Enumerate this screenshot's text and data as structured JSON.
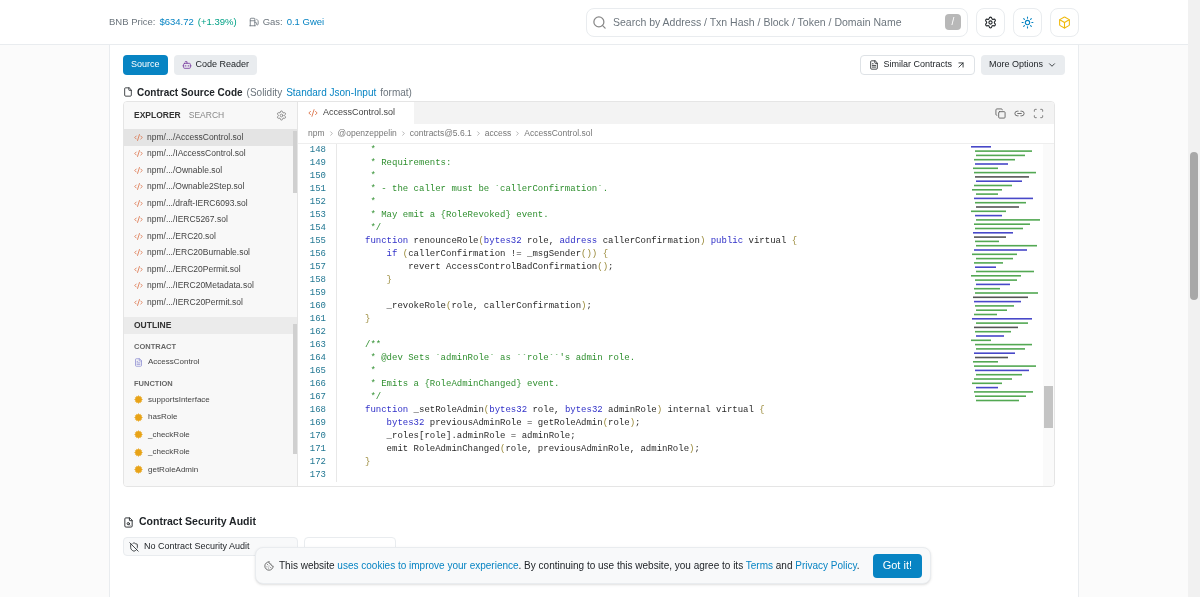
{
  "header": {
    "price_label": "BNB Price:",
    "price": "$634.72",
    "price_change": "(+1.39%)",
    "gas_label": "Gas:",
    "gas": "0.1 Gwei",
    "search": {
      "placeholder": "Search by Address / Txn Hash / Block / Token / Domain Name",
      "shortcut": "/"
    }
  },
  "view_tabs": [
    {
      "label": "Source",
      "selected": true
    },
    {
      "label": "Code Reader",
      "selected": false
    }
  ],
  "actions": {
    "similar": "Similar Contracts",
    "more": "More Options"
  },
  "source_title": {
    "bold": "Contract Source Code",
    "before": "(Solidity",
    "link": "Standard Json-Input",
    "after": "format)"
  },
  "sidebar": {
    "tabs": [
      {
        "label": "EXPLORER",
        "selected": true
      },
      {
        "label": "SEARCH",
        "selected": false
      }
    ],
    "files": [
      {
        "name": "npm/.../AccessControl.sol",
        "selected": true
      },
      {
        "name": "npm/.../IAccessControl.sol",
        "selected": false
      },
      {
        "name": "npm/.../Ownable.sol",
        "selected": false
      },
      {
        "name": "npm/.../Ownable2Step.sol",
        "selected": false
      },
      {
        "name": "npm/.../draft-IERC6093.sol",
        "selected": false
      },
      {
        "name": "npm/.../IERC5267.sol",
        "selected": false
      },
      {
        "name": "npm/.../ERC20.sol",
        "selected": false
      },
      {
        "name": "npm/.../ERC20Burnable.sol",
        "selected": false
      },
      {
        "name": "npm/.../ERC20Permit.sol",
        "selected": false
      },
      {
        "name": "npm/.../IERC20Metadata.sol",
        "selected": false
      },
      {
        "name": "npm/.../IERC20Permit.sol",
        "selected": false
      }
    ],
    "outline_title": "OUTLINE",
    "outline": [
      {
        "heading": "CONTRACT",
        "kind": "contract",
        "items": [
          "AccessControl"
        ]
      },
      {
        "heading": "FUNCTION",
        "kind": "function",
        "items": [
          "supportsInterface",
          "hasRole",
          "_checkRole",
          "_checkRole",
          "getRoleAdmin"
        ]
      }
    ]
  },
  "editor": {
    "tab": "AccessControl.sol",
    "breadcrumb": [
      "npm",
      "@openzeppelin",
      "contracts@5.6.1",
      "access",
      "AccessControl.sol"
    ],
    "lines": [
      {
        "number": "148",
        "tokens": [
          {
            "kind": "comment",
            "text": " *"
          }
        ]
      },
      {
        "number": "149",
        "tokens": [
          {
            "kind": "comment",
            "text": " * Requirements:"
          }
        ]
      },
      {
        "number": "150",
        "tokens": [
          {
            "kind": "comment",
            "text": " *"
          }
        ]
      },
      {
        "number": "151",
        "tokens": [
          {
            "kind": "comment",
            "text": " * - the caller must be `callerConfirmation`."
          }
        ]
      },
      {
        "number": "152",
        "tokens": [
          {
            "kind": "comment",
            "text": " *"
          }
        ]
      },
      {
        "number": "153",
        "tokens": [
          {
            "kind": "comment",
            "text": " * May emit a {RoleRevoked} event."
          }
        ]
      },
      {
        "number": "154",
        "tokens": [
          {
            "kind": "comment",
            "text": " */"
          }
        ]
      },
      {
        "number": "155",
        "tokens": [
          {
            "kind": "keyword",
            "text": "function"
          },
          {
            "kind": "plain",
            "text": " renounceRole"
          },
          {
            "kind": "bracket",
            "text": "("
          },
          {
            "kind": "keyword",
            "text": "bytes32"
          },
          {
            "kind": "plain",
            "text": " role, "
          },
          {
            "kind": "keyword",
            "text": "address"
          },
          {
            "kind": "plain",
            "text": " callerConfirmation"
          },
          {
            "kind": "bracket",
            "text": ")"
          },
          {
            "kind": "keyword",
            "text": " public"
          },
          {
            "kind": "plain",
            "text": " virtual "
          },
          {
            "kind": "bracket",
            "text": "{"
          }
        ]
      },
      {
        "number": "156",
        "tokens": [
          {
            "kind": "keyword",
            "text": "    if"
          },
          {
            "kind": "bracket",
            "text": " ("
          },
          {
            "kind": "plain",
            "text": "callerConfirmation != _msgSender"
          },
          {
            "kind": "bracket",
            "text": "())"
          },
          {
            "kind": "bracket",
            "text": " {"
          }
        ]
      },
      {
        "number": "157",
        "tokens": [
          {
            "kind": "plain",
            "text": "        revert AccessControlBadConfirmation"
          },
          {
            "kind": "bracket",
            "text": "()"
          },
          {
            "kind": "plain",
            "text": ";"
          }
        ]
      },
      {
        "number": "158",
        "tokens": [
          {
            "kind": "bracket",
            "text": "    }"
          }
        ]
      },
      {
        "number": "159"
      },
      {
        "number": "160",
        "tokens": [
          {
            "kind": "plain",
            "text": "    _revokeRole"
          },
          {
            "kind": "bracket",
            "text": "("
          },
          {
            "kind": "plain",
            "text": "role, callerConfirmation"
          },
          {
            "kind": "bracket",
            "text": ")"
          },
          {
            "kind": "plain",
            "text": ";"
          }
        ]
      },
      {
        "number": "161",
        "tokens": [
          {
            "kind": "bracket",
            "text": "}"
          }
        ]
      },
      {
        "number": "162"
      },
      {
        "number": "163",
        "tokens": [
          {
            "kind": "comment",
            "text": "/**"
          }
        ]
      },
      {
        "number": "164",
        "tokens": [
          {
            "kind": "comment",
            "text": " * @dev Sets `adminRole` as ``role``'s admin role."
          }
        ]
      },
      {
        "number": "165",
        "tokens": [
          {
            "kind": "comment",
            "text": " *"
          }
        ]
      },
      {
        "number": "166",
        "tokens": [
          {
            "kind": "comment",
            "text": " * Emits a {RoleAdminChanged} event."
          }
        ]
      },
      {
        "number": "167",
        "tokens": [
          {
            "kind": "comment",
            "text": " */"
          }
        ]
      },
      {
        "number": "168",
        "tokens": [
          {
            "kind": "keyword",
            "text": "function"
          },
          {
            "kind": "plain",
            "text": " _setRoleAdmin"
          },
          {
            "kind": "bracket",
            "text": "("
          },
          {
            "kind": "keyword",
            "text": "bytes32"
          },
          {
            "kind": "plain",
            "text": " role, "
          },
          {
            "kind": "keyword",
            "text": "bytes32"
          },
          {
            "kind": "plain",
            "text": " adminRole"
          },
          {
            "kind": "bracket",
            "text": ")"
          },
          {
            "kind": "plain",
            "text": " internal virtual "
          },
          {
            "kind": "bracket",
            "text": "{"
          }
        ]
      },
      {
        "number": "169",
        "tokens": [
          {
            "kind": "keyword",
            "text": "    bytes32"
          },
          {
            "kind": "plain",
            "text": " previousAdminRole = getRoleAdmin"
          },
          {
            "kind": "bracket",
            "text": "("
          },
          {
            "kind": "plain",
            "text": "role"
          },
          {
            "kind": "bracket",
            "text": ")"
          },
          {
            "kind": "plain",
            "text": ";"
          }
        ]
      },
      {
        "number": "170",
        "tokens": [
          {
            "kind": "plain",
            "text": "    _roles[role].adminRole = adminRole;"
          }
        ]
      },
      {
        "number": "171",
        "tokens": [
          {
            "kind": "plain",
            "text": "    emit RoleAdminChanged"
          },
          {
            "kind": "bracket",
            "text": "("
          },
          {
            "kind": "plain",
            "text": "role, previousAdminRole, adminRole"
          },
          {
            "kind": "bracket",
            "text": ")"
          },
          {
            "kind": "plain",
            "text": ";"
          }
        ]
      },
      {
        "number": "172",
        "tokens": [
          {
            "kind": "bracket",
            "text": "}"
          }
        ]
      },
      {
        "number": "173"
      }
    ]
  },
  "audit": {
    "title": "Contract Security Audit",
    "button": "No Contract Security Audit"
  },
  "cookie": {
    "before": "This website",
    "link1": "uses cookies to improve your experience",
    "middle": ". By continuing to use this website, you agree to its",
    "link2": "Terms",
    "and": "and",
    "link3": "Privacy Policy",
    "end": ".",
    "button": "Got it!"
  }
}
